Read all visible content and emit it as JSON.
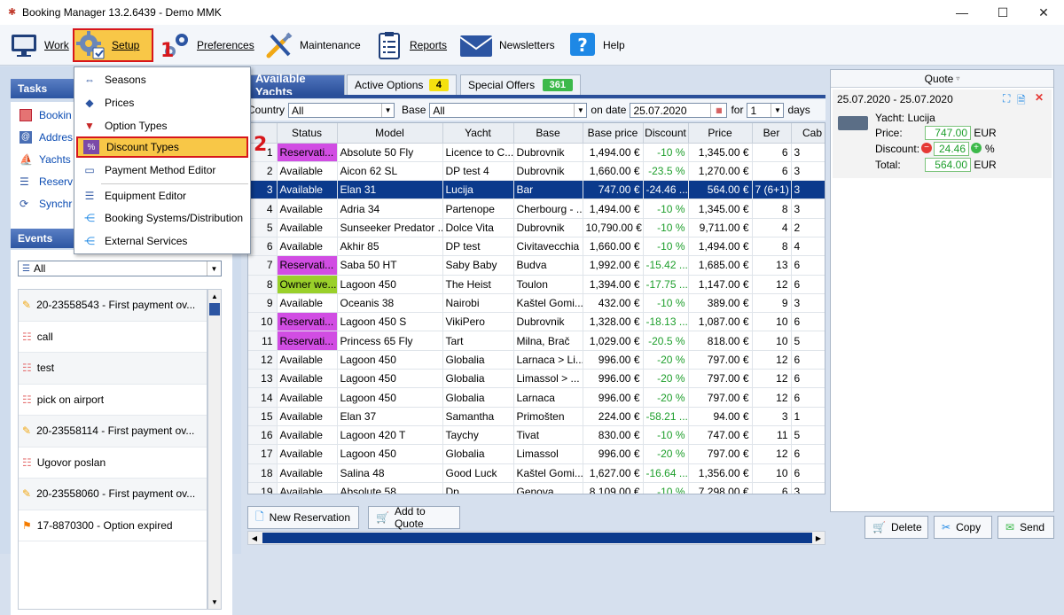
{
  "window": {
    "title": "Booking Manager 13.2.6439 - Demo MMK"
  },
  "toolbar": {
    "work": "Work",
    "setup": "Setup",
    "preferences": "Preferences",
    "maintenance": "Maintenance",
    "reports": "Reports",
    "newsletters": "Newsletters",
    "help": "Help"
  },
  "annotations": {
    "step1": "1",
    "step2": "2"
  },
  "setup_menu": {
    "items": [
      "Seasons",
      "Prices",
      "Option Types",
      "Discount Types",
      "Payment Method Editor",
      "Equipment Editor",
      "Booking Systems/Distribution",
      "External Services"
    ],
    "highlighted": "Discount Types"
  },
  "tasks": {
    "title": "Tasks",
    "items": [
      "Bookin",
      "Addres",
      "Yachts",
      "Reserv",
      "Synchr"
    ]
  },
  "events": {
    "title": "Events",
    "filter": "All",
    "items": [
      "20-23558543 - First payment ov...",
      "call",
      "test",
      "pick on airport",
      "20-23558114 - First payment ov...",
      "Ugovor poslan",
      "20-23558060 - First payment ov...",
      "17-8870300 - Option expired"
    ]
  },
  "tabs": [
    {
      "label": "Available Yachts",
      "badge": ""
    },
    {
      "label": "Active Options",
      "badge": "4"
    },
    {
      "label": "Special Offers",
      "badge": "361"
    }
  ],
  "filters": {
    "country_label": "Country",
    "country_value": "All",
    "base_label": "Base",
    "base_value": "All",
    "on_date_label": "on date",
    "on_date_value": "25.07.2020",
    "for_label": "for",
    "for_value": "1",
    "days_label": "days"
  },
  "grid": {
    "columns": [
      "",
      "Status",
      "Model",
      "Yacht",
      "Base",
      "Base price",
      "Discount",
      "Price",
      "Ber",
      "Cab"
    ],
    "rows": [
      [
        "1",
        "Reservati...",
        "Absolute 50 Fly",
        "Licence to C...",
        "Dubrovnik",
        "1,494.00 €",
        "-10 %",
        "1,345.00 €",
        "6",
        "3"
      ],
      [
        "2",
        "Available",
        "Aicon 62 SL",
        "DP test 4",
        "Dubrovnik",
        "1,660.00 €",
        "-23.5 %",
        "1,270.00 €",
        "6",
        "3"
      ],
      [
        "3",
        "Available",
        "Elan 31",
        "Lucija",
        "Bar",
        "747.00 €",
        "-24.46 ...",
        "564.00 €",
        "7 (6+1)",
        "3"
      ],
      [
        "4",
        "Available",
        "Adria 34",
        "Partenope",
        "Cherbourg - ...",
        "1,494.00 €",
        "-10 %",
        "1,345.00 €",
        "8",
        "3"
      ],
      [
        "5",
        "Available",
        "Sunseeker Predator ...",
        "Dolce Vita",
        "Dubrovnik",
        "10,790.00 €",
        "-10 %",
        "9,711.00 €",
        "4",
        "2"
      ],
      [
        "6",
        "Available",
        "Akhir 85",
        "DP test",
        "Civitavecchia",
        "1,660.00 €",
        "-10 %",
        "1,494.00 €",
        "8",
        "4"
      ],
      [
        "7",
        "Reservati...",
        "Saba 50 HT",
        "Saby Baby",
        "Budva",
        "1,992.00 €",
        "-15.42 ...",
        "1,685.00 €",
        "13",
        "6"
      ],
      [
        "8",
        "Owner we...",
        "Lagoon 450",
        "The Heist",
        "Toulon",
        "1,394.00 €",
        "-17.75 ...",
        "1,147.00 €",
        "12",
        "6"
      ],
      [
        "9",
        "Available",
        "Oceanis 38",
        "Nairobi",
        "Kaštel Gomi...",
        "432.00 €",
        "-10 %",
        "389.00 €",
        "9",
        "3"
      ],
      [
        "10",
        "Reservati...",
        "Lagoon 450 S",
        "VikiPero",
        "Dubrovnik",
        "1,328.00 €",
        "-18.13 ...",
        "1,087.00 €",
        "10",
        "6"
      ],
      [
        "11",
        "Reservati...",
        "Princess 65 Fly",
        "Tart",
        "Milna, Brač",
        "1,029.00 €",
        "-20.5 %",
        "818.00 €",
        "10",
        "5"
      ],
      [
        "12",
        "Available",
        "Lagoon 450",
        "Globalia",
        "Larnaca > Li...",
        "996.00 €",
        "-20 %",
        "797.00 €",
        "12",
        "6"
      ],
      [
        "13",
        "Available",
        "Lagoon 450",
        "Globalia",
        "Limassol > ...",
        "996.00 €",
        "-20 %",
        "797.00 €",
        "12",
        "6"
      ],
      [
        "14",
        "Available",
        "Lagoon 450",
        "Globalia",
        "Larnaca",
        "996.00 €",
        "-20 %",
        "797.00 €",
        "12",
        "6"
      ],
      [
        "15",
        "Available",
        "Elan 37",
        "Samantha",
        "Primošten",
        "224.00 €",
        "-58.21 ...",
        "94.00 €",
        "3",
        "1"
      ],
      [
        "16",
        "Available",
        "Lagoon 420 T",
        "Taychy",
        "Tivat",
        "830.00 €",
        "-10 %",
        "747.00 €",
        "11",
        "5"
      ],
      [
        "17",
        "Available",
        "Lagoon 450",
        "Globalia",
        "Limassol",
        "996.00 €",
        "-20 %",
        "797.00 €",
        "12",
        "6"
      ],
      [
        "18",
        "Available",
        "Salina 48",
        "Good Luck",
        "Kaštel Gomi...",
        "1,627.00 €",
        "-16.64 ...",
        "1,356.00 €",
        "10",
        "6"
      ],
      [
        "19",
        "Available",
        "Absolute 58",
        "Dp",
        "Genova",
        "8,109.00 €",
        "-10 %",
        "7,298.00 €",
        "6",
        "3"
      ]
    ]
  },
  "actions": {
    "new_reservation": "New Reservation",
    "add_to_quote": "Add to Quote"
  },
  "quote": {
    "title": "Quote",
    "date_range": "25.07.2020 - 25.07.2020",
    "yacht": "Yacht: Lucija",
    "price_label": "Price:",
    "price_value": "747.00",
    "currency": "EUR",
    "discount_label": "Discount:",
    "discount_value": "24.46",
    "percent": "%",
    "total_label": "Total:",
    "total_value": "564.00"
  },
  "quote_actions": {
    "delete": "Delete",
    "copy": "Copy",
    "send": "Send"
  },
  "colors": {
    "accent": "#2a4f99",
    "highlight": "#f8c747",
    "annotation_red": "#d7161b",
    "reservation": "#d14de3",
    "owner_week": "#9ad02a",
    "discount_green": "#1d9e2b"
  }
}
